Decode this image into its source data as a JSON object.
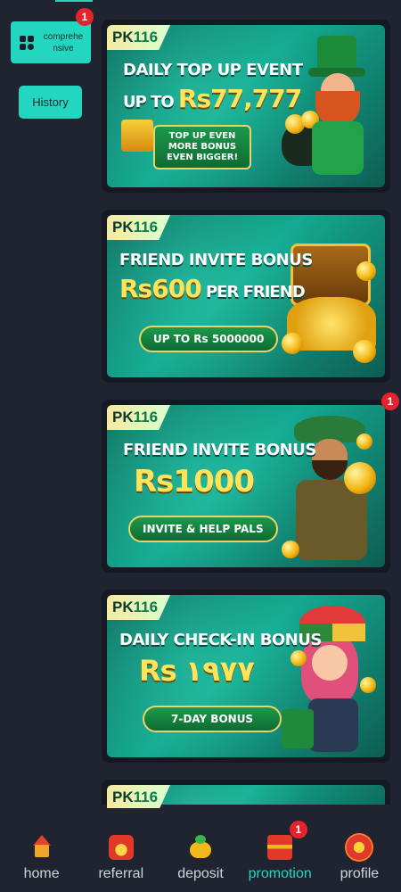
{
  "sidebar": {
    "tab_label": "comprehe nsive",
    "tab_badge": "1",
    "history_label": "History"
  },
  "banners": [
    {
      "logo_prefix": "PK",
      "logo_number": "116",
      "title": "DAILY TOP UP EVENT",
      "amount_prefix": "UP TO ",
      "amount": "Rs77,777",
      "button": "TOP UP EVEN MORE BONUS EVEN BIGGER!",
      "badge": ""
    },
    {
      "logo_prefix": "PK",
      "logo_number": "116",
      "title": "FRIEND INVITE BONUS",
      "amount": "Rs600",
      "amount_suffix": " PER FRIEND",
      "button": "UP TO Rs 5000000",
      "badge": ""
    },
    {
      "logo_prefix": "PK",
      "logo_number": "116",
      "title": "FRIEND INVITE BONUS",
      "amount": "Rs1000",
      "button": "INVITE & HELP PALS",
      "badge": "1"
    },
    {
      "logo_prefix": "PK",
      "logo_number": "116",
      "title": "DAILY CHECK-IN BONUS",
      "amount": "Rs  ۱۹۷۷",
      "button": "7-DAY BONUS",
      "badge": ""
    },
    {
      "logo_prefix": "PK",
      "logo_number": "116"
    }
  ],
  "nav": [
    {
      "label": "home",
      "icon": "home-icon",
      "active": false
    },
    {
      "label": "referral",
      "icon": "referral-icon",
      "active": false
    },
    {
      "label": "deposit",
      "icon": "deposit-icon",
      "active": false
    },
    {
      "label": "promotion",
      "icon": "promotion-icon",
      "active": true,
      "badge": "1"
    },
    {
      "label": "profile",
      "icon": "profile-icon",
      "active": false
    }
  ],
  "colors": {
    "background": "#1f2430",
    "accent": "#22d6c0",
    "badge": "#e5232f"
  }
}
